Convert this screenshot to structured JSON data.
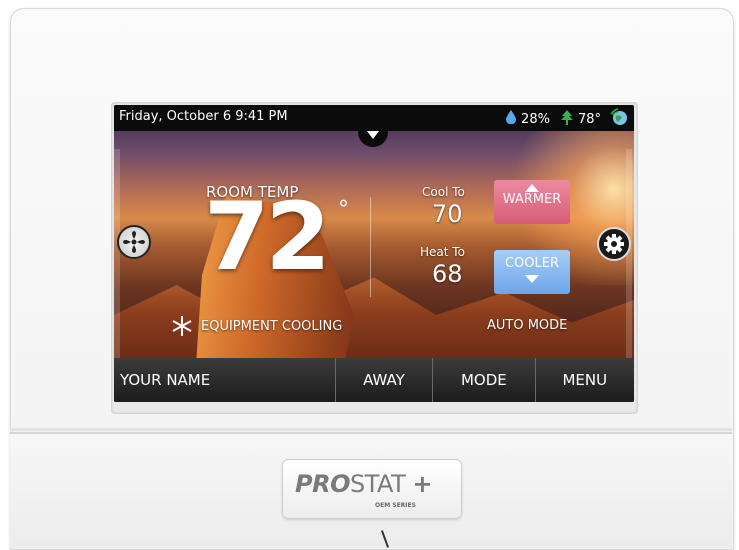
{
  "status": {
    "datetime": "Friday, October 6 9:41 PM",
    "humidity": "28%",
    "outdoor_temp": "78°"
  },
  "room": {
    "label": "ROOM TEMP",
    "temp": "72",
    "degree": "°"
  },
  "setpoints": {
    "cool_label": "Cool To",
    "cool_value": "70",
    "heat_label": "Heat To",
    "heat_value": "68"
  },
  "buttons": {
    "warmer": "WARMER",
    "cooler": "COOLER"
  },
  "status_messages": {
    "equipment": "EQUIPMENT COOLING",
    "mode": "AUTO MODE"
  },
  "nav": {
    "name": "YOUR NAME",
    "away": "AWAY",
    "mode": "MODE",
    "menu": "MENU"
  },
  "brand": {
    "bold": "PRO",
    "rest": "STAT",
    "plus": "+",
    "sub": "OEM SERIES"
  },
  "colors": {
    "warmer": "#d65c78",
    "cooler": "#6da5ea",
    "nav_bg": "#2a2a2a"
  },
  "icons": [
    "water-drop-icon",
    "tree-icon",
    "wifi-globe-icon",
    "chevron-down-icon",
    "fan-icon",
    "gear-icon",
    "snowflake-icon",
    "arrow-up-icon",
    "arrow-down-icon"
  ]
}
